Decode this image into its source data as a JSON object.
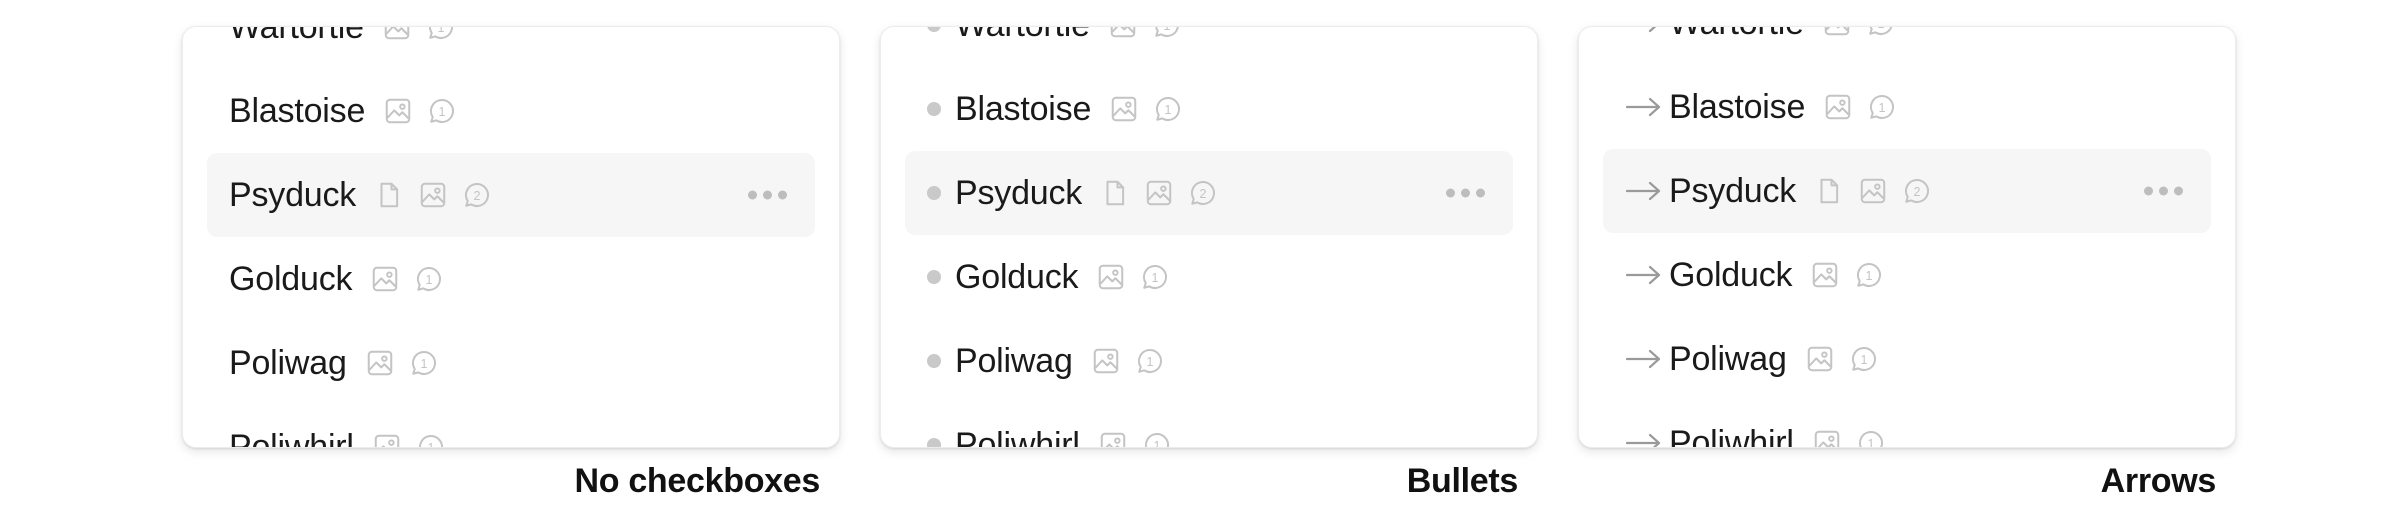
{
  "panels": [
    {
      "id": "no-checkboxes",
      "caption": "No checkboxes",
      "marker": "none",
      "items": [
        {
          "name": "Wartortle",
          "doc": false,
          "image": true,
          "comments": "1",
          "selected": false
        },
        {
          "name": "Blastoise",
          "doc": false,
          "image": true,
          "comments": "1",
          "selected": false
        },
        {
          "name": "Psyduck",
          "doc": true,
          "image": true,
          "comments": "2",
          "selected": true
        },
        {
          "name": "Golduck",
          "doc": false,
          "image": true,
          "comments": "1",
          "selected": false
        },
        {
          "name": "Poliwag",
          "doc": false,
          "image": true,
          "comments": "1",
          "selected": false
        },
        {
          "name": "Poliwhirl",
          "doc": false,
          "image": true,
          "comments": "1",
          "selected": false
        }
      ]
    },
    {
      "id": "bullets",
      "caption": "Bullets",
      "marker": "bullet",
      "items": [
        {
          "name": "Wartortle",
          "doc": false,
          "image": true,
          "comments": "1",
          "selected": false
        },
        {
          "name": "Blastoise",
          "doc": false,
          "image": true,
          "comments": "1",
          "selected": false
        },
        {
          "name": "Psyduck",
          "doc": true,
          "image": true,
          "comments": "2",
          "selected": true
        },
        {
          "name": "Golduck",
          "doc": false,
          "image": true,
          "comments": "1",
          "selected": false
        },
        {
          "name": "Poliwag",
          "doc": false,
          "image": true,
          "comments": "1",
          "selected": false
        },
        {
          "name": "Poliwhirl",
          "doc": false,
          "image": true,
          "comments": "1",
          "selected": false
        }
      ]
    },
    {
      "id": "arrows",
      "caption": "Arrows",
      "marker": "arrow",
      "items": [
        {
          "name": "Wartortle",
          "doc": false,
          "image": true,
          "comments": "1",
          "selected": false
        },
        {
          "name": "Blastoise",
          "doc": false,
          "image": true,
          "comments": "1",
          "selected": false
        },
        {
          "name": "Psyduck",
          "doc": true,
          "image": true,
          "comments": "2",
          "selected": true
        },
        {
          "name": "Golduck",
          "doc": false,
          "image": true,
          "comments": "1",
          "selected": false
        },
        {
          "name": "Poliwag",
          "doc": false,
          "image": true,
          "comments": "1",
          "selected": false
        },
        {
          "name": "Poliwhirl",
          "doc": false,
          "image": true,
          "comments": "1",
          "selected": false
        }
      ]
    }
  ],
  "icons": {
    "document": "document-icon",
    "image": "image-icon",
    "comment": "comment-bubble-icon",
    "more": "more-options-icon",
    "bullet": "bullet-icon",
    "arrow": "arrow-right-icon"
  },
  "colors": {
    "selected_row": "#f6f6f6",
    "icon": "#c4c4c4",
    "bullet": "#c9c9c9",
    "arrow": "#9a9a9a"
  }
}
